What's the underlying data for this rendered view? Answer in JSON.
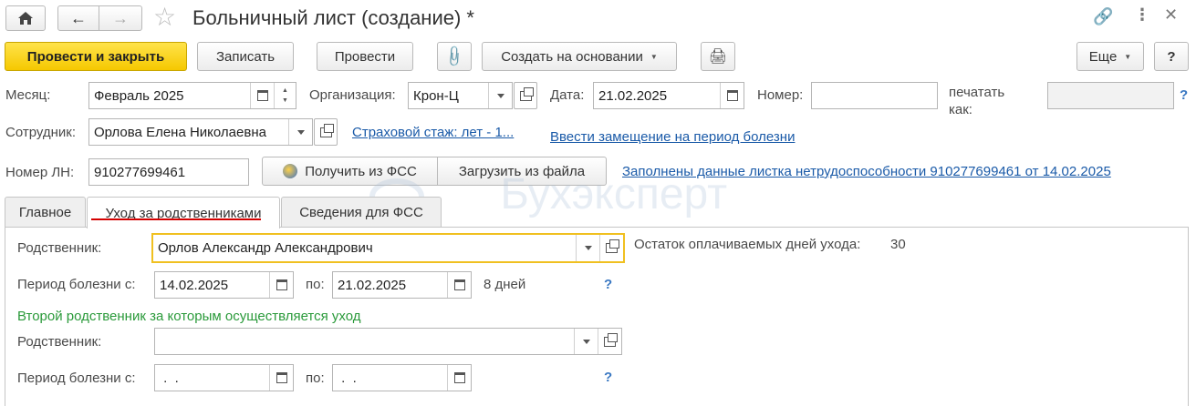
{
  "window": {
    "title": "Больничный лист (создание) *"
  },
  "toolbar": {
    "post_close": "Провести и закрыть",
    "write": "Записать",
    "post": "Провести",
    "create_based_on": "Создать на основании",
    "more": "Еще",
    "help": "?"
  },
  "header": {
    "month_label": "Месяц:",
    "month_value": "Февраль 2025",
    "org_label": "Организация:",
    "org_value": "Крон-Ц",
    "date_label": "Дата:",
    "date_value": "21.02.2025",
    "number_label": "Номер:",
    "number_value": "",
    "print_as_label": "печатать как:",
    "print_as_value": "",
    "employee_label": "Сотрудник:",
    "employee_value": "Орлова Елена Николаевна",
    "insurance_link": "Страховой стаж: лет - 1...",
    "substitution_link": "Ввести замещение на период болезни",
    "ln_label": "Номер ЛН:",
    "ln_value": "910277699461",
    "get_fss_button": "Получить из ФСС",
    "load_file_button": "Загрузить из файла",
    "filled_link": "Заполнены данные листка нетрудоспособности 910277699461 от 14.02.2025",
    "help_q": "?"
  },
  "tabs": [
    {
      "label": "Главное"
    },
    {
      "label": "Уход за родственниками"
    },
    {
      "label": "Сведения для ФСС"
    }
  ],
  "care": {
    "relative_label": "Родственник:",
    "relative_value": "Орлов Александр Александрович",
    "remaining_label": "Остаток оплачиваемых дней ухода:",
    "remaining_value": "30",
    "period_label": "Период болезни с:",
    "period_from": "14.02.2025",
    "to_label": "по:",
    "period_to": "21.02.2025",
    "days": "8 дней",
    "help_q": "?",
    "second_header": "Второй родственник за которым осуществляется уход",
    "relative2_label": "Родственник:",
    "relative2_value": "",
    "period2_label": "Период болезни с:",
    "period2_from": " .  .",
    "to2_label": "по:",
    "period2_to": " .  .",
    "help2_q": "?"
  },
  "watermark": "Бухэксперт",
  "colors": {
    "primary": "#f5c800",
    "link": "#1a5aa8",
    "section_header": "#2a9a3a",
    "focus_border": "#f0c020",
    "tab_underline": "#d40000"
  }
}
